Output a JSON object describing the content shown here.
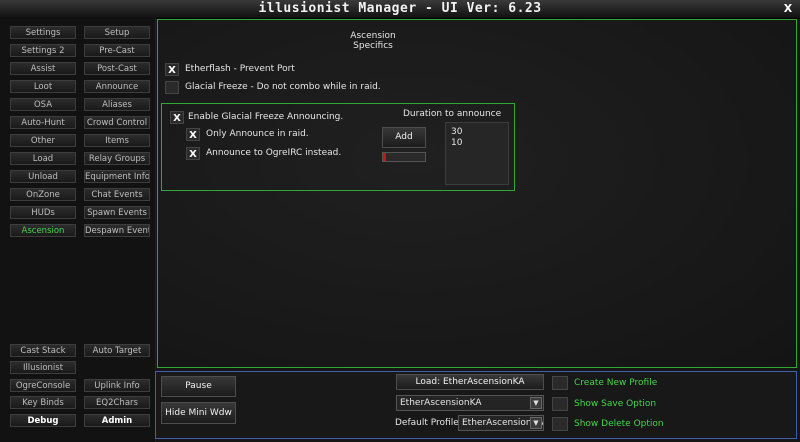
{
  "window": {
    "title": "illusionist Manager  - UI Ver: 6.23",
    "close_label": "X"
  },
  "sidebar": {
    "items": [
      {
        "left": "Settings",
        "right": "Setup"
      },
      {
        "left": "Settings 2",
        "right": "Pre-Cast"
      },
      {
        "left": "Assist",
        "right": "Post-Cast"
      },
      {
        "left": "Loot",
        "right": "Announce"
      },
      {
        "left": "OSA",
        "right": "Aliases"
      },
      {
        "left": "Auto-Hunt",
        "right": "Crowd Control"
      },
      {
        "left": "Other",
        "right": "Items"
      },
      {
        "left": "Load",
        "right": "Relay Groups"
      },
      {
        "left": "Unload",
        "right": "Equipment Info"
      },
      {
        "left": "OnZone",
        "right": "Chat Events"
      },
      {
        "left": "HUDs",
        "right": "Spawn Events"
      },
      {
        "left": "Ascension",
        "right": "Despawn Event"
      }
    ],
    "bottom": {
      "cast_stack": "Cast Stack",
      "auto_target": "Auto Target",
      "illusionist": "Illusionist",
      "ogre_console": "OgreConsole",
      "uplink_info": "Uplink Info",
      "key_binds": "Key Binds",
      "eq2chars": "EQ2Chars",
      "debug": "Debug",
      "admin": "Admin"
    }
  },
  "main": {
    "section_title": "Ascension Specifics",
    "etherflash": {
      "checked": "X",
      "label": "Etherflash - Prevent Port"
    },
    "glacial_combo": {
      "checked": "",
      "label": "Glacial Freeze - Do not combo while in raid."
    },
    "group": {
      "enable": {
        "checked": "X",
        "label": "Enable Glacial Freeze Announcing."
      },
      "raid_only": {
        "checked": "X",
        "label": "Only Announce in raid."
      },
      "ogreirc": {
        "checked": "X",
        "label": "Announce to OgreIRC instead."
      },
      "duration_title": "Duration to announce",
      "add_label": "Add",
      "progress": 0.08,
      "durations": [
        "30",
        "10"
      ]
    }
  },
  "footer": {
    "pause": "Pause",
    "hide_mini": "Hide Mini Wdw",
    "load_label": "Load: EtherAscensionKA",
    "profile_select": "EtherAscensionKA",
    "default_profile_label": "Default Profile:",
    "default_profile_value": "EtherAscensionKA",
    "create_new": "Create New Profile",
    "show_save": "Show Save Option",
    "show_delete": "Show Delete Option"
  }
}
